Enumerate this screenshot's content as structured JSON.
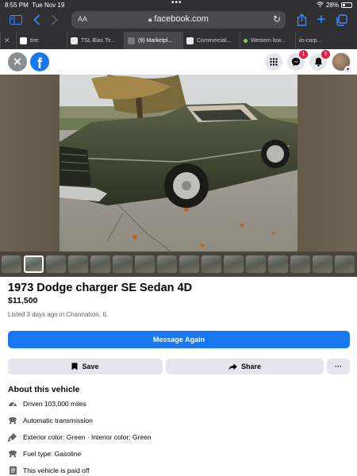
{
  "status": {
    "time": "8:55 PM",
    "date": "Tue Nov 19",
    "battery": "28%"
  },
  "browser": {
    "aa_label": "AA",
    "url": "facebook.com",
    "tabs": [
      {
        "label": "tire:"
      },
      {
        "label": "TSL Bias Tir..."
      },
      {
        "label": "(9) Marketpl..."
      },
      {
        "label": "Commercial..."
      },
      {
        "label": "Western low..."
      },
      {
        "label": "iis-carp..."
      }
    ]
  },
  "header": {
    "logo": "f",
    "messenger_badge": "1",
    "notifications_badge": "9"
  },
  "listing": {
    "title": "1973 Dodge charger SE Sedan 4D",
    "price": "$11,500",
    "listed": "Listed 3 days ago in Channahon, IL",
    "message_button": "Message Again",
    "save_button": "Save",
    "share_button": "Share",
    "more_button": "···"
  },
  "about": {
    "heading": "About this vehicle",
    "items": [
      {
        "icon": "odometer-icon",
        "text": "Driven 103,000 miles"
      },
      {
        "icon": "transmission-icon",
        "text": "Automatic transmission"
      },
      {
        "icon": "paint-icon",
        "text": "Exterior color: Green · Interior color: Green"
      },
      {
        "icon": "fuel-icon",
        "text": "Fuel type: Gasoline"
      },
      {
        "icon": "document-icon",
        "text": "This vehicle is paid off"
      }
    ]
  },
  "colors": {
    "brand": "#1877f2",
    "badge": "#e41e3f",
    "chrome": "#303033"
  }
}
